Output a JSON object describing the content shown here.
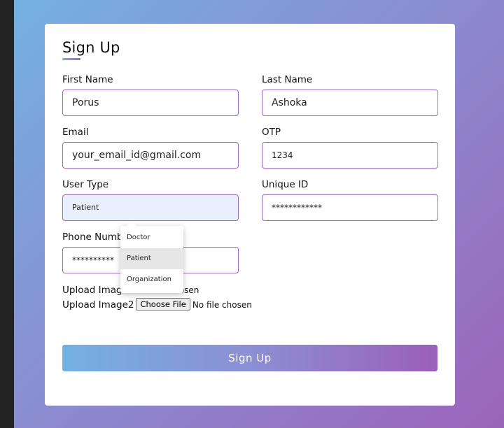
{
  "form": {
    "title": "Sign Up",
    "first_name": {
      "label": "First Name",
      "value": "Porus"
    },
    "last_name": {
      "label": "Last Name",
      "value": "Ashoka"
    },
    "email": {
      "label": "Email",
      "value": "your_email_id@gmail.com"
    },
    "otp": {
      "label": "OTP",
      "value": "1234"
    },
    "user_type": {
      "label": "User Type",
      "value": "Patient",
      "options": [
        "Doctor",
        "Patient",
        "Organization"
      ]
    },
    "unique_id": {
      "label": "Unique ID",
      "value": "************"
    },
    "phone": {
      "label": "Phone Number",
      "label_visible": "Phone Numb",
      "value": "**********"
    },
    "upload1": {
      "label": "Upload Image",
      "label_visible": "Upload Imag",
      "status": "No file chosen"
    },
    "upload2": {
      "label": "Upload Image2",
      "button": "Choose File",
      "status": "No file chosen"
    },
    "submit_label": "Sign Up"
  },
  "colors": {
    "gradient_start": "#74b1e2",
    "gradient_end": "#9c64bb",
    "field_border": "#9a6bc2",
    "select_bg": "#e8effd"
  }
}
